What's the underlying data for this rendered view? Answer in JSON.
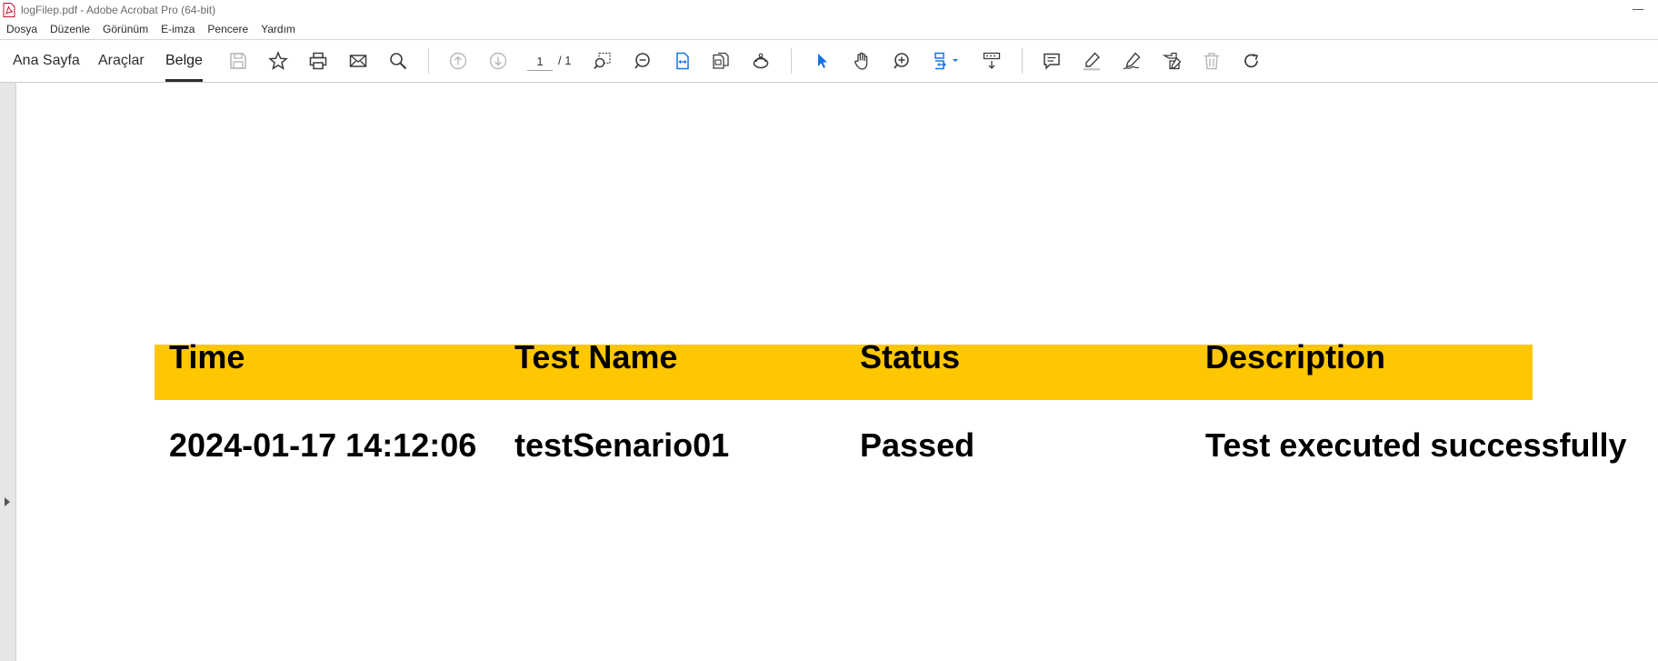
{
  "window": {
    "title": "logFilep.pdf - Adobe Acrobat Pro (64-bit)"
  },
  "menu": [
    "Dosya",
    "Düzenle",
    "Görünüm",
    "E-imza",
    "Pencere",
    "Yardım"
  ],
  "nav_tabs": [
    {
      "label": "Ana Sayfa",
      "active": false
    },
    {
      "label": "Araçlar",
      "active": false
    },
    {
      "label": "Belge",
      "active": true
    }
  ],
  "toolbar": {
    "page_current": "1",
    "page_total": "/ 1",
    "icons": [
      "save-icon",
      "bookmark-star-icon",
      "print-icon",
      "email-icon",
      "find-icon",
      "previous-page-icon",
      "next-page-icon",
      "marquee-zoom-icon",
      "zoom-out-icon",
      "fit-width-icon",
      "page-layout-icon",
      "read-mode-icon",
      "select-cursor-icon",
      "hand-icon",
      "zoom-in-icon",
      "page-display-icon",
      "keyboard-scroll-icon",
      "comment-icon",
      "highlight-icon",
      "draw-icon",
      "sign-icon",
      "delete-icon",
      "rotate-icon"
    ],
    "accent_color": "#1473e6"
  },
  "document": {
    "header_color": "#fec700",
    "headers": [
      "Time",
      "Test Name",
      "Status",
      "Description"
    ],
    "rows": [
      [
        "2024-01-17 14:12:06",
        "testSenario01",
        "Passed",
        "Test executed successfully"
      ]
    ]
  }
}
